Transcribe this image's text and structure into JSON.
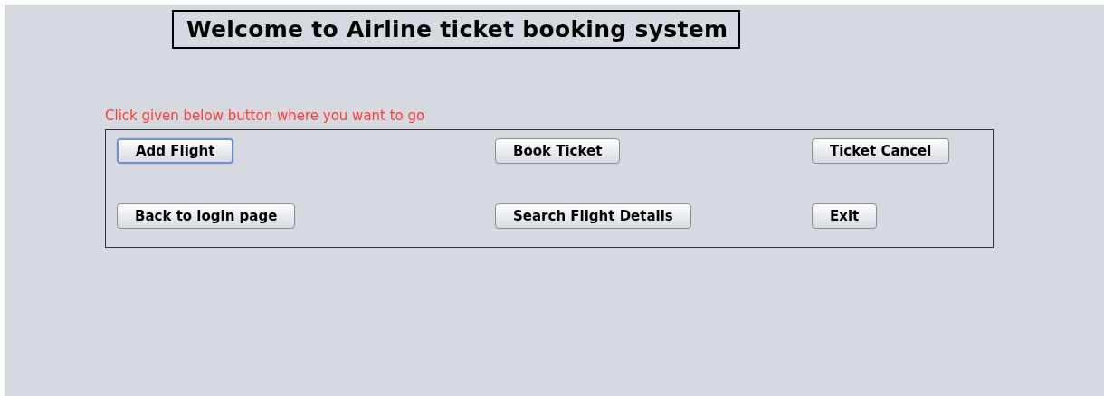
{
  "title": "Welcome to Airline ticket booking system",
  "instruction": "Click given below button where you want to go",
  "buttons": [
    {
      "label": "Add Flight",
      "focused": true
    },
    {
      "label": "Book Ticket",
      "focused": false
    },
    {
      "label": "Ticket Cancel",
      "focused": false
    },
    {
      "label": "Back to login page",
      "focused": false
    },
    {
      "label": "Search Flight Details",
      "focused": false
    },
    {
      "label": "Exit",
      "focused": false
    }
  ]
}
